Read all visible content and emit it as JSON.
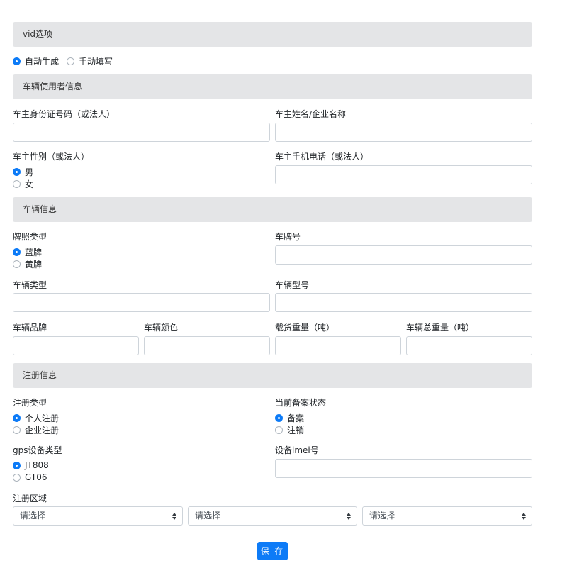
{
  "vid_section": {
    "title": "vid选项",
    "options": [
      {
        "label": "自动生成",
        "checked": true
      },
      {
        "label": "手动填写",
        "checked": false
      }
    ]
  },
  "user_section": {
    "title": "车辆使用者信息",
    "owner_id_label": "车主身份证号码（或法人）",
    "owner_name_label": "车主姓名/企业名称",
    "gender_label": "车主性别（或法人）",
    "gender_options": [
      {
        "label": "男",
        "checked": true
      },
      {
        "label": "女",
        "checked": false
      }
    ],
    "phone_label": "车主手机电话（或法人）"
  },
  "vehicle_section": {
    "title": "车辆信息",
    "plate_type_label": "牌照类型",
    "plate_type_options": [
      {
        "label": "蓝牌",
        "checked": true
      },
      {
        "label": "黄牌",
        "checked": false
      }
    ],
    "plate_number_label": "车牌号",
    "vehicle_type_label": "车辆类型",
    "vehicle_model_label": "车辆型号",
    "brand_label": "车辆品牌",
    "color_label": "车辆颜色",
    "load_weight_label": "载货重量（吨）",
    "total_weight_label": "车辆总重量（吨）"
  },
  "register_section": {
    "title": "注册信息",
    "reg_type_label": "注册类型",
    "reg_type_options": [
      {
        "label": "个人注册",
        "checked": true
      },
      {
        "label": "企业注册",
        "checked": false
      }
    ],
    "filing_status_label": "当前备案状态",
    "filing_status_options": [
      {
        "label": "备案",
        "checked": true
      },
      {
        "label": "注销",
        "checked": false
      }
    ],
    "gps_type_label": "gps设备类型",
    "gps_type_options": [
      {
        "label": "JT808",
        "checked": true
      },
      {
        "label": "GT06",
        "checked": false
      }
    ],
    "imei_label": "设备imei号",
    "region_label": "注册区域",
    "region_selects": [
      "请选择",
      "请选择",
      "请选择"
    ]
  },
  "save_label": "保 存"
}
